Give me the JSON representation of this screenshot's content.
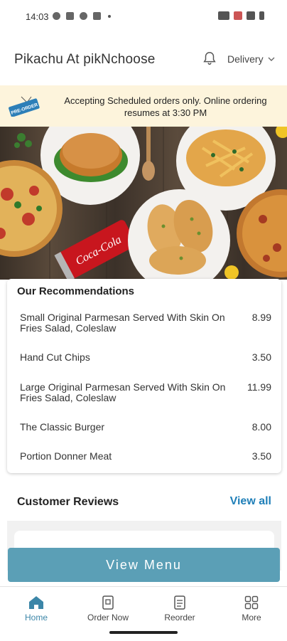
{
  "status_bar": {
    "time": "14:03"
  },
  "header": {
    "title": "Pikachu At pikNchoose",
    "delivery_label": "Delivery"
  },
  "notice": {
    "tag": "PRE-ORDER",
    "text": "Accepting Scheduled orders only. Online ordering resumes at 3:30 PM"
  },
  "hero": {
    "drink_label": "Coca-Cola"
  },
  "recommendations": {
    "title": "Our Recommendations",
    "items": [
      {
        "name": "Small Original Parmesan Served With Skin On Fries Salad, Coleslaw",
        "price": "8.99"
      },
      {
        "name": "Hand Cut Chips",
        "price": "3.50"
      },
      {
        "name": "Large Original Parmesan Served With Skin On Fries Salad, Coleslaw",
        "price": "11.99"
      },
      {
        "name": "The Classic Burger",
        "price": "8.00"
      },
      {
        "name": "Portion Donner Meat",
        "price": "3.50"
      }
    ]
  },
  "reviews": {
    "title": "Customer Reviews",
    "view_all": "View all"
  },
  "cta": {
    "view_menu": "View Menu"
  },
  "nav": {
    "items": [
      {
        "label": "Home",
        "icon": "home-icon"
      },
      {
        "label": "Order Now",
        "icon": "order-icon"
      },
      {
        "label": "Reorder",
        "icon": "reorder-icon"
      },
      {
        "label": "More",
        "icon": "grid-icon"
      }
    ],
    "active": "Home"
  },
  "colors": {
    "accent": "#5b9fb6",
    "link": "#1f7fb8",
    "nav_active": "#3c86a8",
    "notice_bg": "#fdf4dc"
  }
}
